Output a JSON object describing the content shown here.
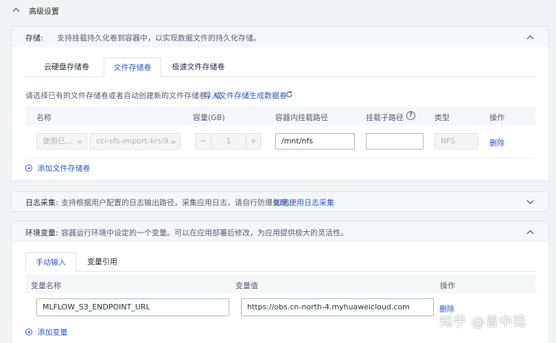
{
  "advanced": {
    "title": "高级设置"
  },
  "storage": {
    "label": "存储:",
    "description": "支持挂载持久化卷到容器中，以实现数据文件的持久化存储。",
    "tabs": [
      "云硬盘存储卷",
      "文件存储卷",
      "极速文件存储卷"
    ],
    "active_tab": 1,
    "hint": "请选择已有的文件存储卷或者自动创建新的文件存储卷，或",
    "import_link": "导入文件存储生成数据卷",
    "headers": [
      "名称",
      "容量(GB)",
      "容器内挂载路径",
      "挂载子路径",
      "类型",
      "操作"
    ],
    "row": {
      "mode": "使用已...",
      "volume": "cci-sfs-import-krsi9...",
      "minus": "−",
      "capacity": "1",
      "plus": "+",
      "mount_path": "/mnt/nfs",
      "sub_path": "",
      "type": "NFS",
      "delete": "删除"
    },
    "add": "添加文件存储卷"
  },
  "log": {
    "label": "日志采集:",
    "description": "支持根据用户配置的日志输出路径，采集应用日志，请自行防爆处理。",
    "link": "如何使用日志采集"
  },
  "env": {
    "label": "环境变量:",
    "description": "容器运行环境中设定的一个变量。可以在应用部署后修改，为应用提供极大的灵活性。",
    "tabs": [
      "手动输入",
      "变量引用"
    ],
    "active_tab": 0,
    "headers": [
      "变量名称",
      "变量值",
      "操作"
    ],
    "row": {
      "name": "MLFLOW_S3_ENDPOINT_URL",
      "value": "https://obs.cn-north-4.myhuaweicloud.com",
      "delete": "删除"
    },
    "add": "添加变量"
  },
  "watermark": "知乎 @曾中铭",
  "colors": {
    "link": "#2d55c7",
    "header_bg": "#f4f6fa",
    "page_bg": "#f2f3f5"
  }
}
